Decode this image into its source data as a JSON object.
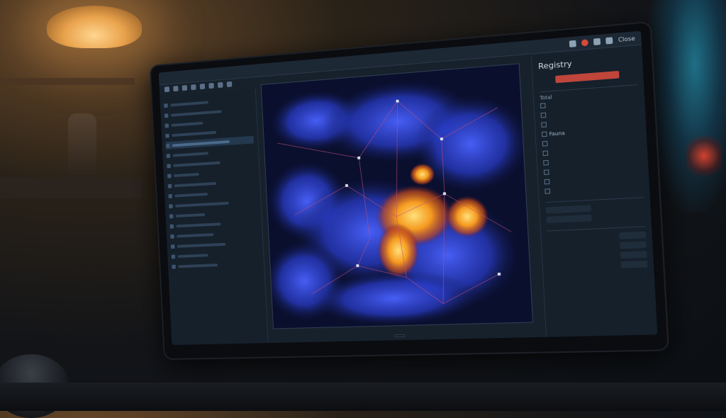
{
  "window": {
    "title": "",
    "titlebar_label": "Close"
  },
  "brand": "",
  "right_panel": {
    "title": "Registry",
    "selected_label": "",
    "subtitle": "",
    "section1": {
      "left": "Total",
      "right": ""
    },
    "attributes": [
      {
        "name": "",
        "value": "",
        "color": "plain"
      },
      {
        "name": "",
        "value": "",
        "color": "plain"
      },
      {
        "name": "",
        "value": "",
        "color": "yellow"
      },
      {
        "name": "Fauna",
        "value": "",
        "color": "plain"
      },
      {
        "name": "",
        "value": "",
        "color": "plain"
      },
      {
        "name": "",
        "value": "",
        "color": "plain"
      },
      {
        "name": "",
        "value": "",
        "color": "green"
      },
      {
        "name": "",
        "value": "",
        "color": "green"
      },
      {
        "name": "",
        "value": "",
        "color": "green"
      },
      {
        "name": "",
        "value": "",
        "color": "green"
      }
    ],
    "section2": {
      "left": "",
      "right": ""
    },
    "section3": {
      "left": "",
      "right": ""
    },
    "list": [
      "",
      "",
      "",
      ""
    ]
  },
  "map": {
    "title": "",
    "caption": ""
  },
  "left_panel": {
    "footer": ""
  },
  "colors": {
    "accent_red": "#c0453a",
    "heat_orange": "#f59a1f",
    "map_blue": "#2b3fd1",
    "status_green": "#5fe06a"
  }
}
